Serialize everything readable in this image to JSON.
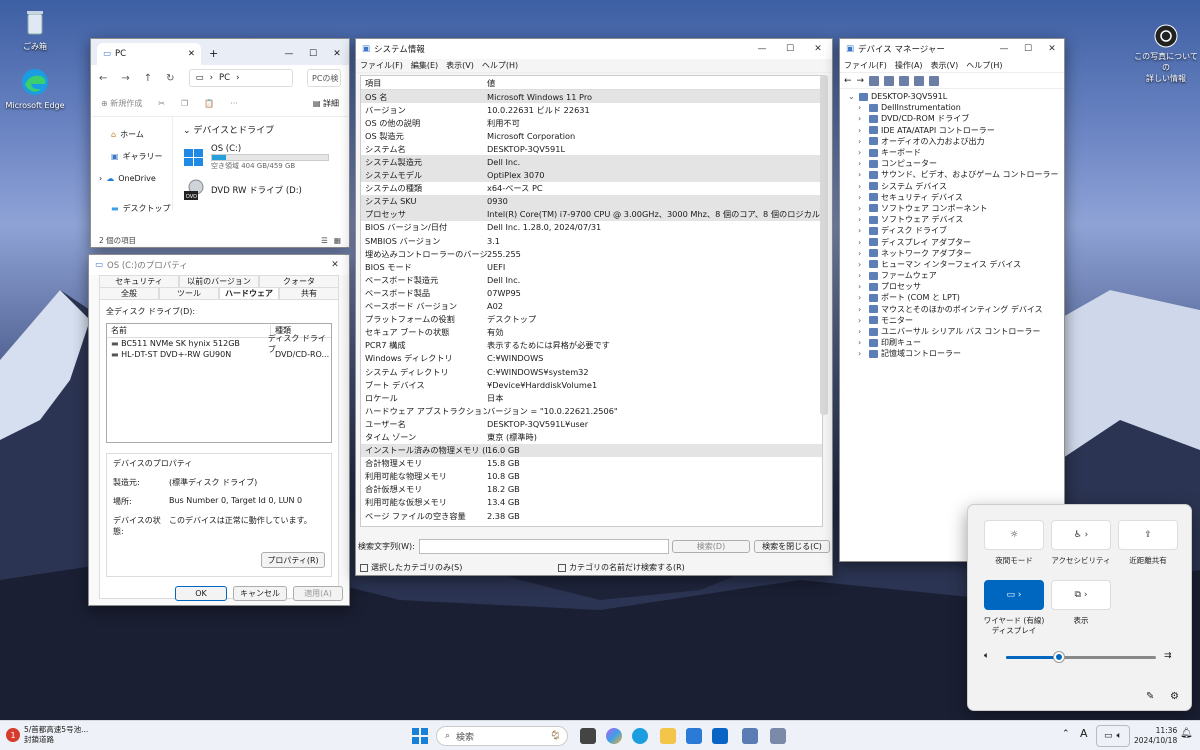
{
  "desktop": {
    "recycle_bin": "ごみ箱",
    "edge": "Microsoft Edge",
    "spotlight": "この写真についての\n詳しい情報"
  },
  "explorer": {
    "tab_title": "PC",
    "address": "PC",
    "search_placeholder": "PCの検",
    "new_label": "新規作成",
    "details_label": "詳細",
    "side_items": [
      "ホーム",
      "ギャラリー",
      "OneDrive",
      "デスクトップ"
    ],
    "section": "デバイスとドライブ",
    "drive_c": {
      "name": "OS (C:)",
      "free": "空き領域 404 GB/459 GB",
      "used_fraction": 0.12
    },
    "drive_d": {
      "name": "DVD RW ドライブ (D:)"
    },
    "dvd_badge": "DVD",
    "status": "2 個の項目"
  },
  "props": {
    "title": "OS (C:)のプロパティ",
    "tabs_row1": [
      "セキュリティ",
      "以前のバージョン",
      "クォータ"
    ],
    "tabs_row2": [
      "全般",
      "ツール",
      "ハードウェア",
      "共有"
    ],
    "all_drives": "全ディスク ドライブ(D):",
    "col_name": "名前",
    "col_type": "種類",
    "drives": [
      {
        "name": "BC511 NVMe SK hynix 512GB",
        "type": "ディスク ドライブ"
      },
      {
        "name": "HL-DT-ST DVD+-RW GU90N",
        "type": "DVD/CD-RO..."
      }
    ],
    "group_title": "デバイスのプロパティ",
    "manufacturer_label": "製造元:",
    "manufacturer": "(標準ディスク ドライブ)",
    "location_label": "場所:",
    "location": "Bus Number 0, Target Id 0, LUN 0",
    "status_label": "デバイスの状態:",
    "status": "このデバイスは正常に動作しています。",
    "props_btn": "プロパティ(R)",
    "ok": "OK",
    "cancel": "キャンセル",
    "apply": "適用(A)"
  },
  "msinfo": {
    "title": "システム情報",
    "menu": [
      "ファイル(F)",
      "編集(E)",
      "表示(V)",
      "ヘルプ(H)"
    ],
    "head_item": "項目",
    "head_value": "値",
    "rows": [
      {
        "k": "OS 名",
        "v": "Microsoft Windows 11 Pro",
        "shade": true
      },
      {
        "k": "バージョン",
        "v": "10.0.22631 ビルド 22631",
        "shade": false
      },
      {
        "k": "OS の他の説明",
        "v": "利用不可",
        "shade": false
      },
      {
        "k": "OS 製造元",
        "v": "Microsoft Corporation",
        "shade": false
      },
      {
        "k": "システム名",
        "v": "DESKTOP-3QV591L",
        "shade": false
      },
      {
        "k": "システム製造元",
        "v": "Dell Inc.",
        "shade": true
      },
      {
        "k": "システムモデル",
        "v": "OptiPlex 3070",
        "shade": true
      },
      {
        "k": "システムの種類",
        "v": "x64-ベース PC",
        "shade": false
      },
      {
        "k": "システム SKU",
        "v": "0930",
        "shade": true
      },
      {
        "k": "プロセッサ",
        "v": "Intel(R) Core(TM) i7-9700 CPU @ 3.00GHz、3000 Mhz、8 個のコア、8 個のロジカル プロセッサ",
        "shade": true
      },
      {
        "k": "BIOS バージョン/日付",
        "v": "Dell Inc. 1.28.0, 2024/07/31",
        "shade": false
      },
      {
        "k": "SMBIOS バージョン",
        "v": "3.1",
        "shade": false
      },
      {
        "k": "埋め込みコントローラーのバージョン",
        "v": "255.255",
        "shade": false
      },
      {
        "k": "BIOS モード",
        "v": "UEFI",
        "shade": false
      },
      {
        "k": "ベースボード製造元",
        "v": "Dell Inc.",
        "shade": false
      },
      {
        "k": "ベースボード製品",
        "v": "07WP95",
        "shade": false
      },
      {
        "k": "ベースボード バージョン",
        "v": "A02",
        "shade": false
      },
      {
        "k": "プラットフォームの役割",
        "v": "デスクトップ",
        "shade": false
      },
      {
        "k": "セキュア ブートの状態",
        "v": "有効",
        "shade": false
      },
      {
        "k": "PCR7 構成",
        "v": "表示するためには昇格が必要です",
        "shade": false
      },
      {
        "k": "Windows ディレクトリ",
        "v": "C:¥WINDOWS",
        "shade": false
      },
      {
        "k": "システム ディレクトリ",
        "v": "C:¥WINDOWS¥system32",
        "shade": false
      },
      {
        "k": "ブート デバイス",
        "v": "¥Device¥HarddiskVolume1",
        "shade": false
      },
      {
        "k": "ロケール",
        "v": "日本",
        "shade": false
      },
      {
        "k": "ハードウェア アブストラクション レイヤー",
        "v": "バージョン = \"10.0.22621.2506\"",
        "shade": false
      },
      {
        "k": "ユーザー名",
        "v": "DESKTOP-3QV591L¥user",
        "shade": false
      },
      {
        "k": "タイム ゾーン",
        "v": "東京 (標準時)",
        "shade": false
      },
      {
        "k": "インストール済みの物理メモリ (RAM)",
        "v": "16.0 GB",
        "shade": true
      },
      {
        "k": "合計物理メモリ",
        "v": "15.8 GB",
        "shade": false
      },
      {
        "k": "利用可能な物理メモリ",
        "v": "10.8 GB",
        "shade": false
      },
      {
        "k": "合計仮想メモリ",
        "v": "18.2 GB",
        "shade": false
      },
      {
        "k": "利用可能な仮想メモリ",
        "v": "13.4 GB",
        "shade": false
      },
      {
        "k": "ページ ファイルの空き容量",
        "v": "2.38 GB",
        "shade": false
      }
    ],
    "find_label": "検索文字列(W):",
    "find_btn": "検索(D)",
    "close_find_btn": "検索を閉じる(C)",
    "chk_selected": "選択したカテゴリのみ(S)",
    "chk_names": "カテゴリの名前だけ検索する(R)"
  },
  "devmgr": {
    "title": "デバイス マネージャー",
    "menu": [
      "ファイル(F)",
      "操作(A)",
      "表示(V)",
      "ヘルプ(H)"
    ],
    "root": "DESKTOP-3QV591L",
    "items": [
      "DellInstrumentation",
      "DVD/CD-ROM ドライブ",
      "IDE ATA/ATAPI コントローラー",
      "オーディオの入力および出力",
      "キーボード",
      "コンピューター",
      "サウンド、ビデオ、およびゲーム コントローラー",
      "システム デバイス",
      "セキュリティ デバイス",
      "ソフトウェア コンポーネント",
      "ソフトウェア デバイス",
      "ディスク ドライブ",
      "ディスプレイ アダプター",
      "ネットワーク アダプター",
      "ヒューマン インターフェイス デバイス",
      "ファームウェア",
      "プロセッサ",
      "ポート (COM と LPT)",
      "マウスとそのほかのポインティング デバイス",
      "モニター",
      "ユニバーサル シリアル バス コントローラー",
      "印刷キュー",
      "記憶域コントローラー"
    ]
  },
  "quick": {
    "night": "夜間モード",
    "access": "アクセシビリティ",
    "share": "近距離共有",
    "cast": "ワイヤード (有線)\nディスプレイ",
    "display": "表示",
    "volume_fraction": 0.35
  },
  "taskbar": {
    "news_line1": "5/首都高速5号池...",
    "news_line2": "封鎖道路",
    "search": "検索",
    "time": "11:36",
    "date": "2024/10/18",
    "ime": "A",
    "news_badge": "1"
  }
}
